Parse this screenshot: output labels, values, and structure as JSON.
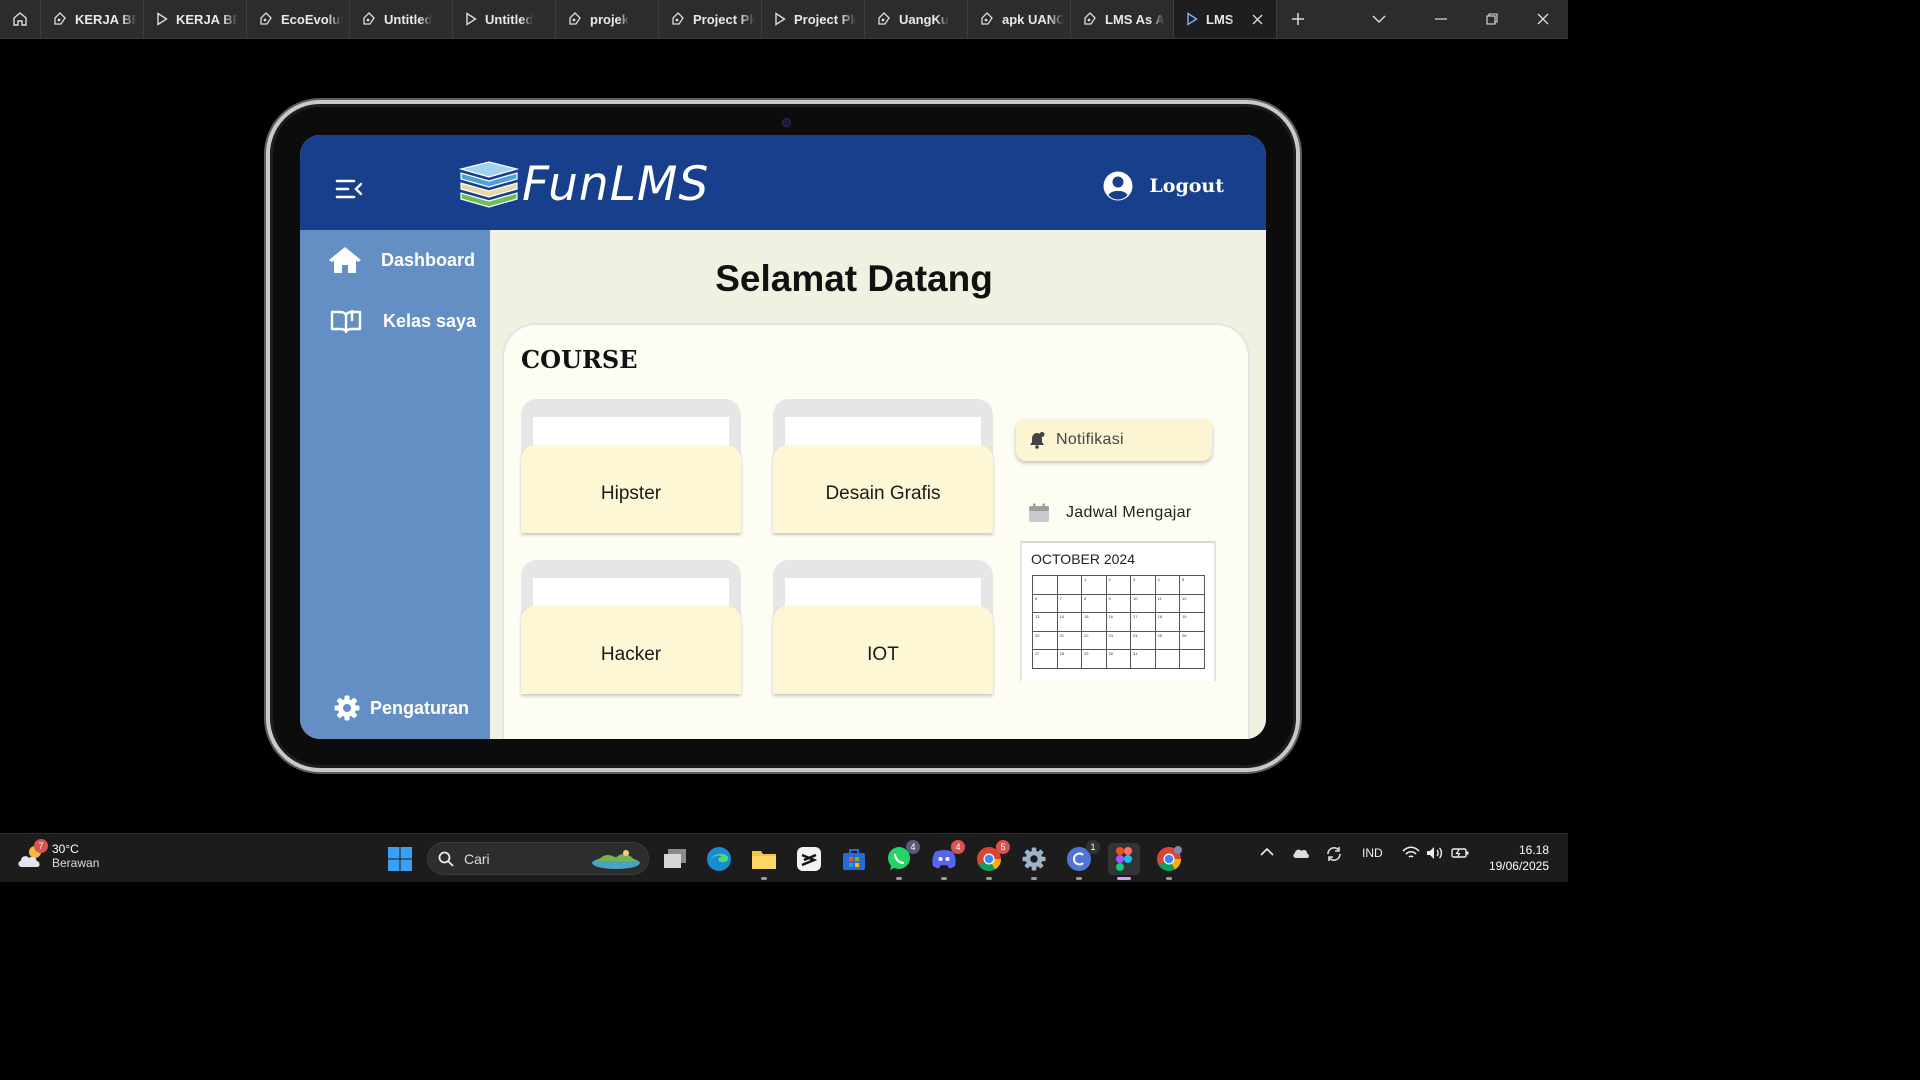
{
  "browser": {
    "tabs": [
      {
        "label": "KERJA BR",
        "icon": "figma-pen-icon"
      },
      {
        "label": "KERJA BR",
        "icon": "figma-play-icon"
      },
      {
        "label": "EcoEvolut",
        "icon": "figma-pen-icon"
      },
      {
        "label": "Untitled",
        "icon": "figma-pen-icon"
      },
      {
        "label": "Untitled",
        "icon": "figma-play-icon"
      },
      {
        "label": "projek",
        "icon": "figma-pen-icon"
      },
      {
        "label": "Project Pk",
        "icon": "figma-pen-icon"
      },
      {
        "label": "Project Pk",
        "icon": "figma-play-icon"
      },
      {
        "label": "UangKu",
        "icon": "figma-pen-icon"
      },
      {
        "label": "apk UANG",
        "icon": "figma-pen-icon"
      },
      {
        "label": "LMS As A",
        "icon": "figma-pen-icon"
      },
      {
        "label": "LMS A",
        "icon": "figma-play-icon",
        "active": true
      }
    ]
  },
  "app": {
    "logo_text": "FunLMS",
    "logout_label": "Logout",
    "welcome_title": "Selamat Datang",
    "sidebar": {
      "dashboard": "Dashboard",
      "kelas": "Kelas saya",
      "settings": "Pengaturan"
    },
    "course_heading": "COURSE",
    "courses": [
      "Hipster",
      "Desain Grafis",
      "Hacker",
      "IOT"
    ],
    "notification_label": "Notifikasi",
    "schedule_label": "Jadwal Mengajar",
    "calendar": {
      "month": "OCTOBER 2024",
      "days": [
        "",
        "",
        "1",
        "2",
        "3",
        "4",
        "5",
        "6",
        "7",
        "8",
        "9",
        "10",
        "11",
        "12",
        "13",
        "14",
        "15",
        "16",
        "17",
        "18",
        "19",
        "20",
        "21",
        "22",
        "23",
        "24",
        "25",
        "26",
        "27",
        "28",
        "29",
        "30",
        "31",
        "",
        "",
        ""
      ]
    },
    "colors": {
      "header": "#183f8b",
      "sidebar": "#648fc4",
      "card": "#fdf7d5"
    }
  },
  "taskbar": {
    "weather_badge": "7",
    "temperature": "30°C",
    "condition": "Berawan",
    "search_placeholder": "Cari",
    "whatsapp_badge": "4",
    "discord_badge": "4",
    "chrome_badge": "5",
    "canva_badge": "1",
    "language": "IND",
    "time": "16.18",
    "date": "19/06/2025"
  }
}
